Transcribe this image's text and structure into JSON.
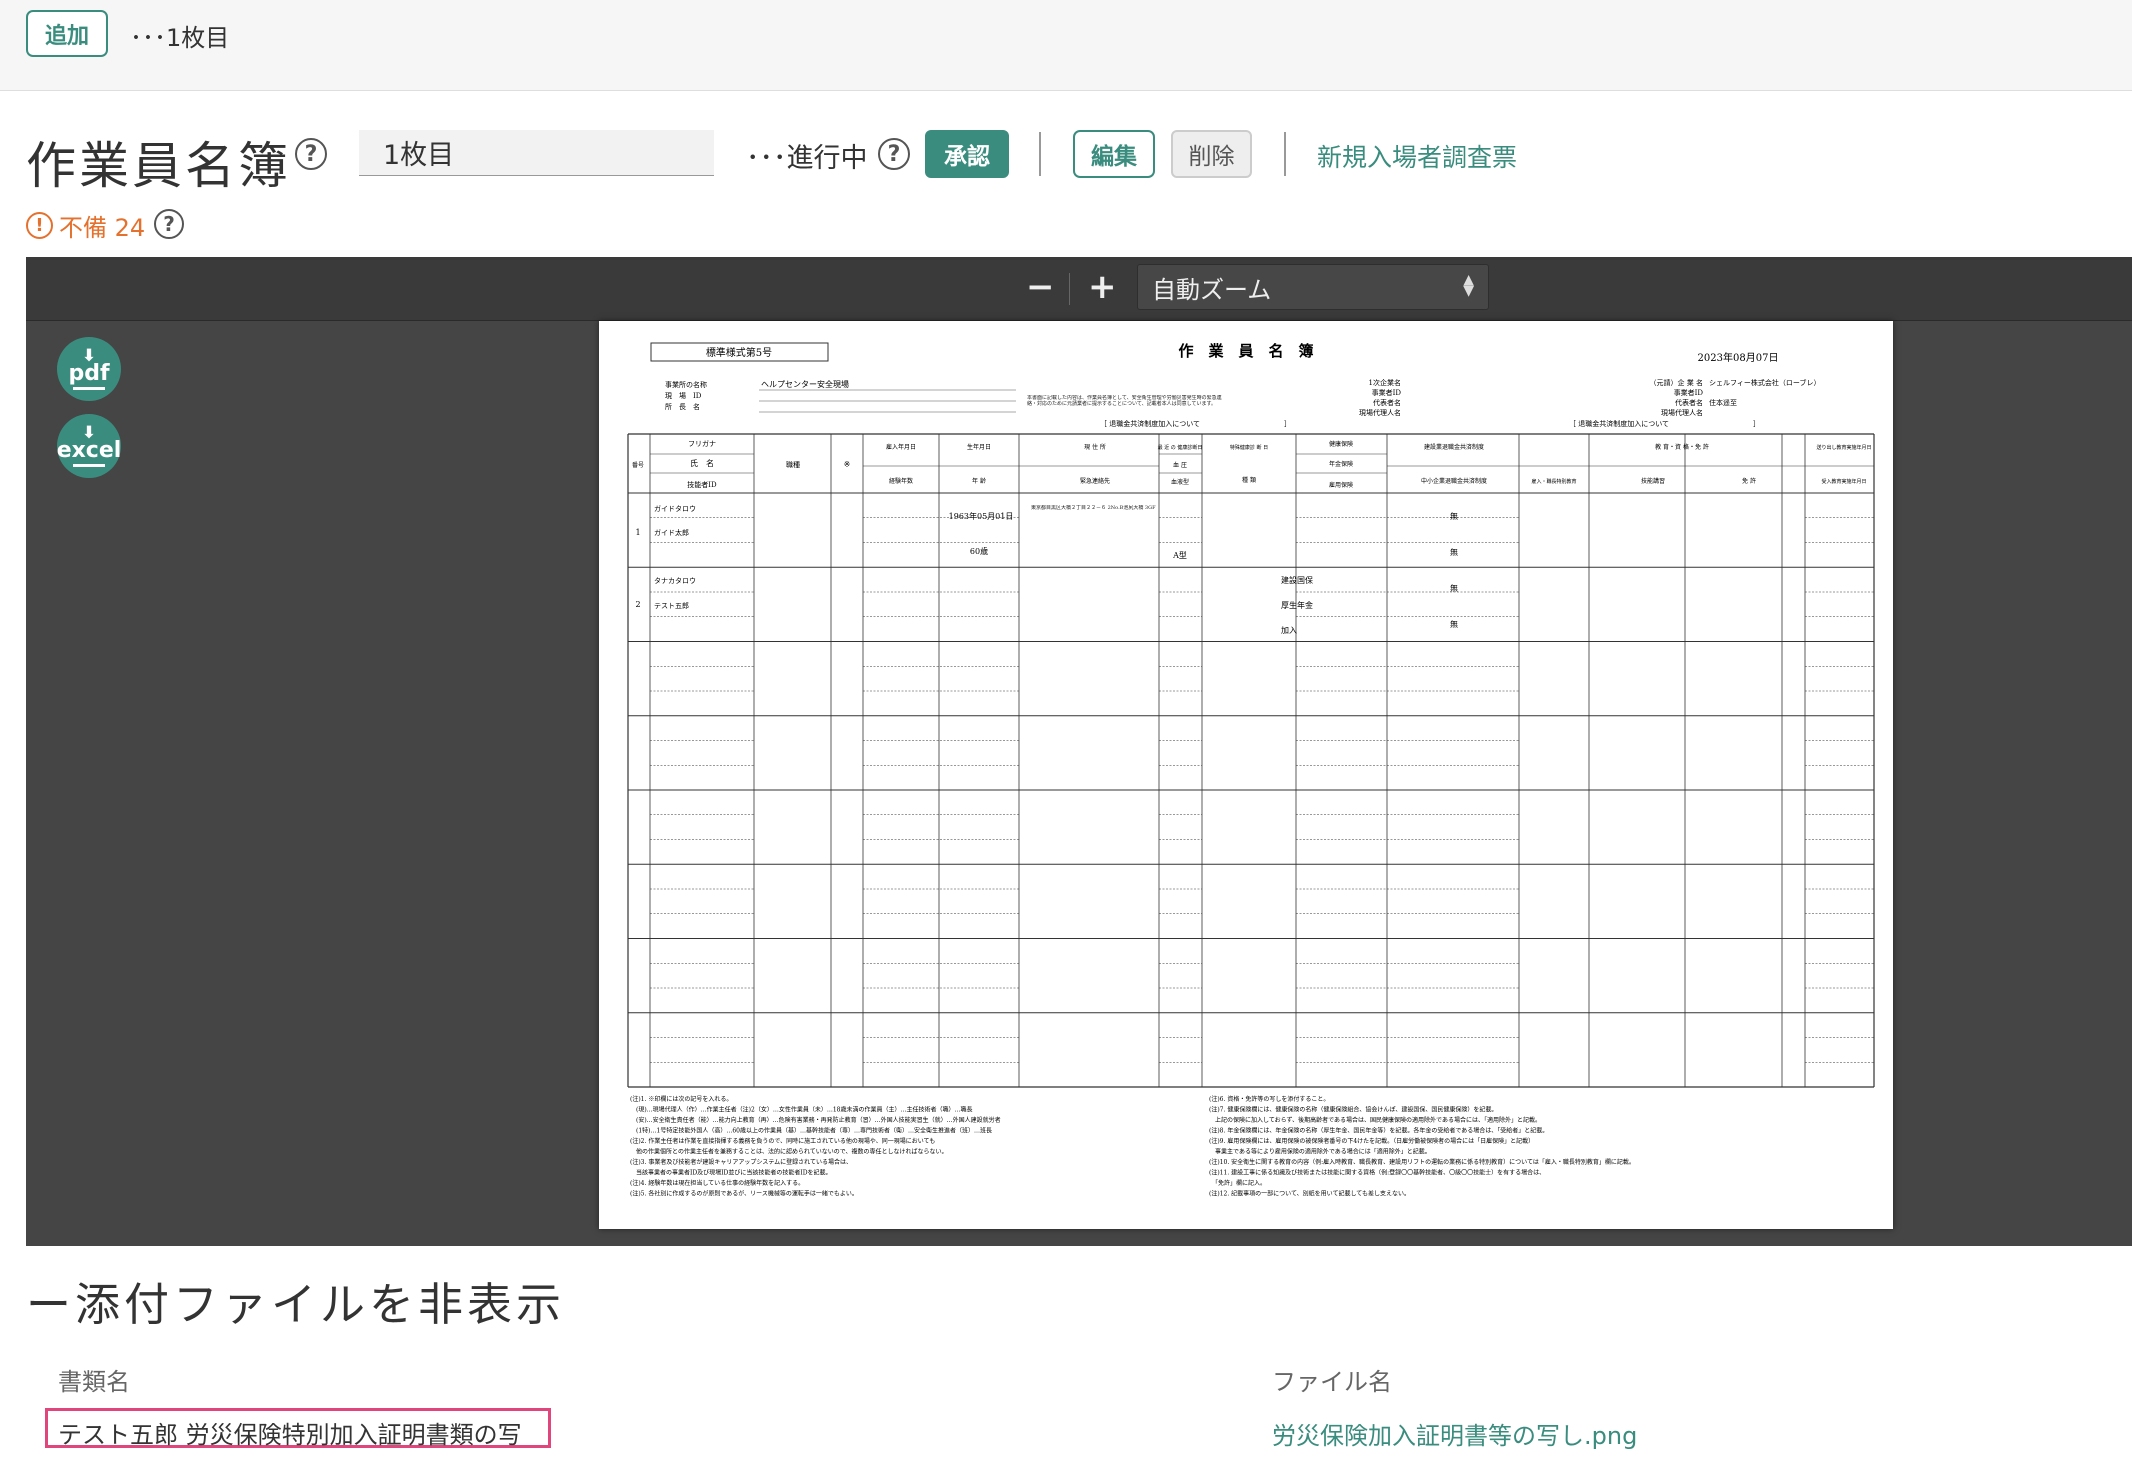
{
  "topbar": {
    "add_label": "追加",
    "page_label": "･･･1枚目"
  },
  "header": {
    "title": "作業員名簿",
    "page_input_value": "1枚目",
    "status_text": "･･･進行中",
    "approve_label": "承認",
    "edit_label": "編集",
    "delete_label": "削除",
    "new_entry_link": "新規入場者調査票",
    "help_glyph": "?"
  },
  "warning": {
    "icon": "!",
    "text": "不備 24"
  },
  "viewer": {
    "zoom_minus": "−",
    "zoom_plus": "+",
    "zoom_value": "自動ズーム",
    "pdf_label": "pdf",
    "excel_label": "excel",
    "document": {
      "form_no": "標準様式第5号",
      "title": "作　業　員　名　簿",
      "date": "2023年08月07日",
      "left_fields": [
        {
          "label": "事業所の名称",
          "value": "ヘルプセンター安全現場"
        },
        {
          "label": "現　場　ID",
          "value": ""
        },
        {
          "label": "所　長　名",
          "value": ""
        }
      ],
      "notice": "本書面に記載した内容は、作業員名簿として、安全衛生管理や労働災害発生時の緊急連絡・対応のために元請業者に提示することについて、記載者本人は同意しています。",
      "right_labels": [
        "1次企業名",
        "事業者ID",
        "代表者名",
        "現場代理人名"
      ],
      "right_labels2": [
        "（元請）企 業 名",
        "事業者ID",
        "代表者名",
        "現場代理人名"
      ],
      "company": "シェルフィー株式会社（ローブレ）",
      "rep_name": "住本遥至",
      "retire_label": "［ 退職金共済制度加入について　　　　　　　　　　　　］",
      "headers": {
        "no": "番号",
        "furigana": "フリガナ",
        "name": "氏　名",
        "tech_id": "技能者ID",
        "job": "職種",
        "mark": "※",
        "hire_date": "雇入年月日",
        "exp_years": "経験年数",
        "birth": "生年月日",
        "age": "年 齢",
        "address": "現 住 所",
        "emergency": "緊急連絡先",
        "health_date": "最 近 の 健康診断日",
        "blood_pressure": "血 圧",
        "blood_type": "血液型",
        "special_health": "特殊健康診 断 日",
        "kind": "種 類",
        "health_ins": "健康保険",
        "pension": "年金保険",
        "employ_ins": "雇用保険",
        "retire_fund": "建設業退職金共済制度",
        "retire_fund2": "中小企業退職金共済制度",
        "education": "教 育・資 格・免 許",
        "edu1": "雇入・職長特別教育",
        "edu2": "技能講習",
        "edu3": "免 許",
        "send_date": "送り出し教育実施年月日",
        "accept_date": "受入教育実施年月日"
      },
      "workers": [
        {
          "no": "1",
          "furigana": "ガイドタロウ",
          "name": "ガイド太郎",
          "birth": "1963年05月01日",
          "age": "60歳",
          "address": "東京都目黒区大橋２丁目２２－６ 2No.B池尻大橋 3GF",
          "blood_type": "A型",
          "retire_a": "無",
          "retire_b": "無"
        },
        {
          "no": "2",
          "furigana": "タナカタロウ",
          "name": "テスト五郎",
          "health_ins": "建設国保",
          "pension": "厚生年金",
          "employ_ins": "加入",
          "retire_a": "無",
          "retire_b": "無"
        }
      ],
      "notes_left": [
        "(注)1. ※印欄には次の記号を入れる。",
        "　(現)…現場代理人（作）…作業主任者（注)2（女）…女性作業員（未）…18歳未満の作業員（主）…主任技術者（職）…職長",
        "　(安)…安全衛生責任者（能）…能力向上教育（再）…危険有害業務・再発防止教育（習）…外国人技能実習生（就）…外国人建設就労者",
        "　(1特)…1号特定技能外国人（高）…60歳以上の作業員（基）…基幹技能者（専）…専門技術者（衛）…安全衛生推進者（班）…班長",
        "(注)2. 作業主任者は作業を直接指揮する義務を負うので、同時に施工されている他の現場や、同一現場においても",
        "　他の作業個所との作業主任者を兼務することは、法的に認められていないので、複数の専任としなければならない。",
        "(注)3. 事業者及び技能者が建設キャリアアップシステムに登録されている場合は、",
        "　当該事業者の事業者ID及び現場ID並びに当該技能者の技能者IDを記載。",
        "(注)4. 経験年数は現在担当している仕事の経験年数を記入する。",
        "(注)5. 各社別に作成するのが原則であるが、リース機械等の運転手は一緒でもよい。"
      ],
      "notes_right": [
        "(注)6. 資格・免許等の写しを添付すること。",
        "(注)7. 健康保険欄には、健康保険の名称（健康保険組合、協会けんぽ、建設国保、国民健康保険）を記載。",
        "　上記の保険に加入しておらず、後期高齢者である場合は、国民健康保険の適用除外である場合には、「適用除外」と記載。",
        "(注)8. 年金保険欄には、年金保険の名称（厚生年金、国民年金等）を記載。各年金の受給者である場合は、「受給者」と記載。",
        "(注)9. 雇用保険欄には、雇用保険の被保険者番号の下4けたを記載。（日雇労働被保険者の場合には「日雇保険」と記載）",
        "　事業主である等により雇用保険の適用除外である場合には「適用除外」と記載。",
        "(注)10. 安全衛生に関する教育の内容（例:雇入時教育、職長教育、建設用リフトの運転の業務に係る特別教育）については「雇入・職長特別教育」欄に記載。",
        "(注)11. 建設工事に係る知識及び技術または技能に関する資格（例:登録〇〇基幹技能者、〇級〇〇技能士）を有する場合は、",
        "　「免許」欄に記入。",
        "(注)12. 記載事項の一部について、別紙を用いて記載しても差し支えない。"
      ]
    }
  },
  "attachments": {
    "toggle_label": "ー添付ファイルを非表示",
    "doc_col": "書類名",
    "file_col": "ファイル名",
    "doc_name": "テスト五郎 労災保険特別加入証明書類の写し",
    "file_name": "労災保険加入証明書等の写し.png"
  },
  "colors": {
    "accent": "#3a8d7e",
    "warning": "#e4712d",
    "highlight": "#e0457b",
    "viewer_bg": "#454545"
  }
}
